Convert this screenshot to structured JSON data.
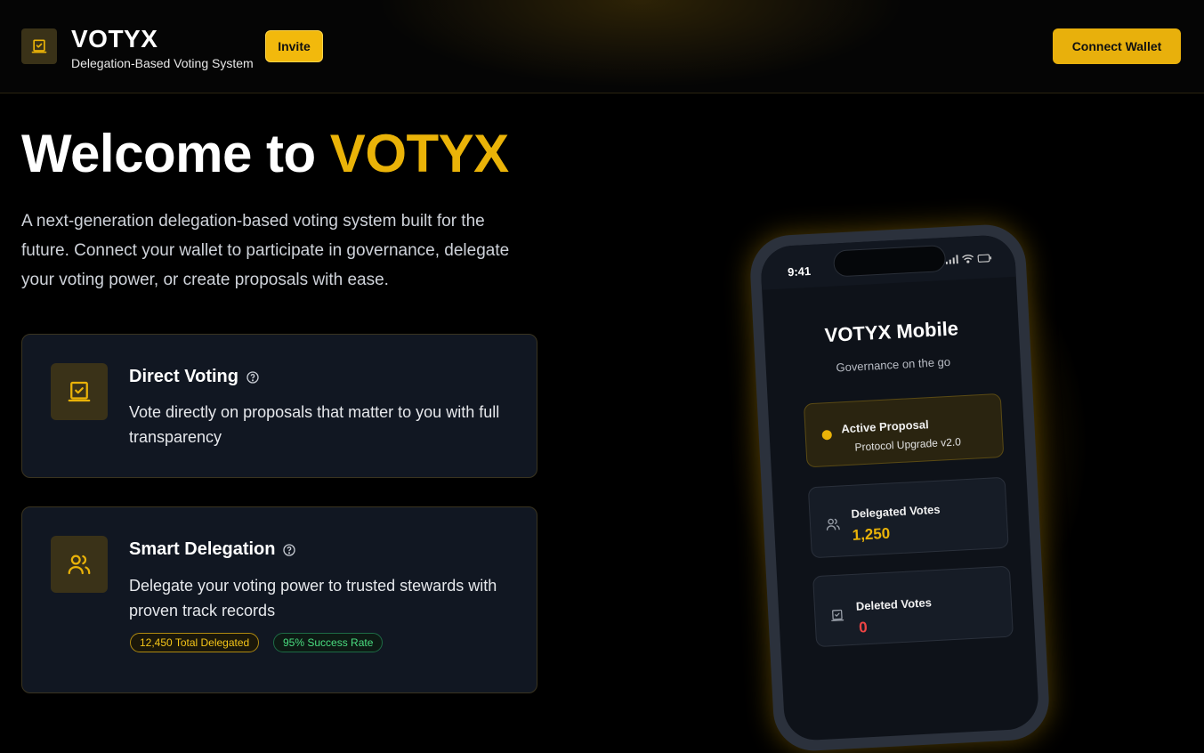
{
  "header": {
    "brand": "VOTYX",
    "tagline": "Delegation-Based Voting System",
    "invite_label": "Invite",
    "connect_label": "Connect Wallet"
  },
  "hero": {
    "title_prefix": "Welcome to ",
    "title_accent": "VOTYX",
    "description": "A next-generation delegation-based voting system built for the future. Connect your wallet to participate in governance, delegate your voting power, or create proposals with ease."
  },
  "features": [
    {
      "title": "Direct Voting",
      "text": "Vote directly on proposals that matter to you with full transparency",
      "icon": "ballot-box-icon"
    },
    {
      "title": "Smart Delegation",
      "text": "Delegate your voting power to trusted stewards with proven track records",
      "icon": "users-icon",
      "badges": [
        "12,450 Total Delegated",
        "95% Success Rate"
      ]
    }
  ],
  "phone": {
    "time": "9:41",
    "title": "VOTYX Mobile",
    "subtitle": "Governance on the go",
    "active": {
      "label": "Active Proposal",
      "detail": "Protocol Upgrade v2.0"
    },
    "delegated": {
      "label": "Delegated Votes",
      "value": "1,250"
    },
    "deleted": {
      "label": "Deleted Votes",
      "value": "0"
    }
  },
  "colors": {
    "accent": "#eab308",
    "success": "#4ade80",
    "danger": "#ef4444"
  }
}
